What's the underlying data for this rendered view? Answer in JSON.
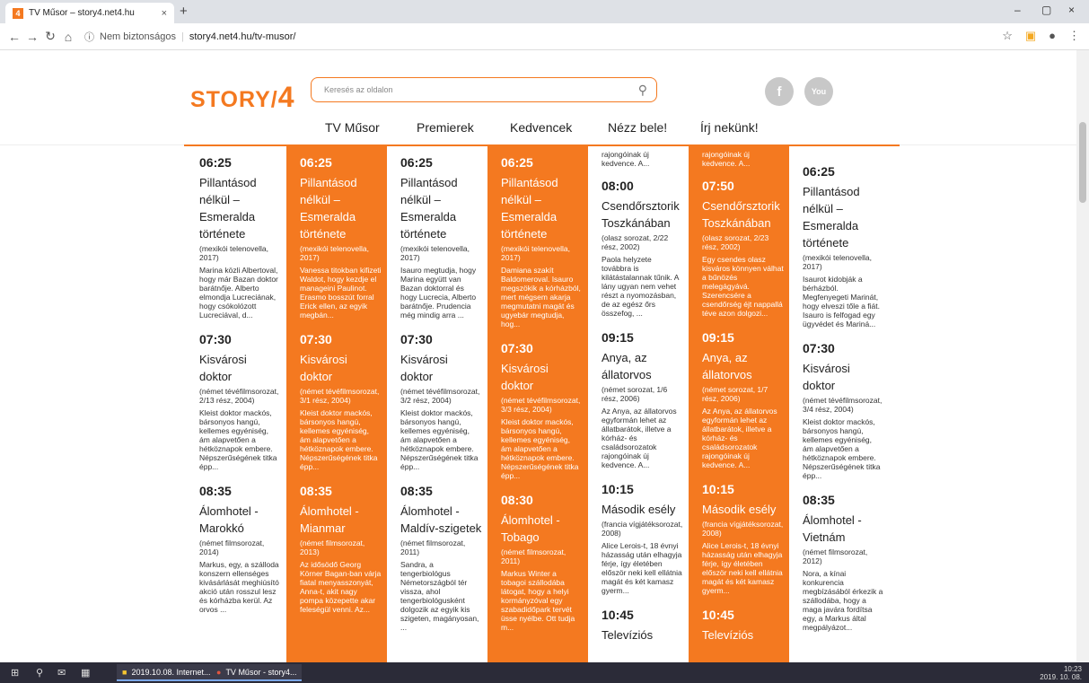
{
  "browser": {
    "tab_title": "TV Műsor – story4.net4.hu",
    "new_tab": "+",
    "security": "Nem biztonságos",
    "url": "story4.net4.hu/tv-musor/",
    "minimize": "–",
    "maximize": "▢",
    "close": "×"
  },
  "site": {
    "logo_text": "STORY/",
    "logo_number": "4",
    "search_placeholder": "Keresés az oldalon",
    "facebook": "f",
    "youtube": "You",
    "menu": [
      "TV Műsor",
      "Premierek",
      "Kedvencek",
      "Nézz bele!",
      "Írj nekünk!"
    ]
  },
  "accent": "#f47920",
  "columns": [
    {
      "orange": false,
      "slots": [
        {
          "time": "06:25",
          "title": "Pillantásod nélkül – Esmeralda története",
          "meta": "(mexikói telenovella, 2017)",
          "desc": "Marina közli Albertoval, hogy már Bazan doktor barátnője. Alberto elmondja Lucreciának, hogy csókolózott Lucreciával, d..."
        },
        {
          "time": "07:30",
          "title": "Kisvárosi doktor",
          "meta": "(német tévéfilmsorozat, 2/13 rész, 2004)",
          "desc": "Kleist doktor mackós, bársonyos hangú, kellemes egyéniség, ám alapvetően a hétköznapok embere. Népszerűségének titka épp..."
        },
        {
          "time": "08:35",
          "title": "Álomhotel - Marokkó",
          "meta": "(német filmsorozat, 2014)",
          "desc": "Markus, egy, a szálloda konszern ellenséges kivásárlását meghiúsító akció után rosszul lesz és kórházba kerül. Az orvos ..."
        }
      ]
    },
    {
      "orange": true,
      "slots": [
        {
          "time": "06:25",
          "title": "Pillantásod nélkül – Esmeralda története",
          "meta": "(mexikói telenovella, 2017)",
          "desc": "Vanessa titokban kifizeti Waldot, hogy kezdje el manageini Paulinot. Erasmo bosszút forral Erick ellen, az egyik megbán..."
        },
        {
          "time": "07:30",
          "title": "Kisvárosi doktor",
          "meta": "(német tévéfilmsorozat, 3/1 rész, 2004)",
          "desc": "Kleist doktor mackós, bársonyos hangú, kellemes egyéniség, ám alapvetően a hétköznapok embere. Népszerűségének titka épp..."
        },
        {
          "time": "08:35",
          "title": "Álomhotel - Mianmar",
          "meta": "(német filmsorozat, 2013)",
          "desc": "Az idősödő Georg Körner Bagan-ban várja fiatal menyasszonyát, Anna-t, akit nagy pompa közepette akar feleségül venni. Az..."
        }
      ]
    },
    {
      "orange": false,
      "slots": [
        {
          "time": "06:25",
          "title": "Pillantásod nélkül – Esmeralda története",
          "meta": "(mexikói telenovella, 2017)",
          "desc": "Isauro megtudja, hogy Marina együtt van Bazan doktorral és hogy Lucrecia, Alberto barátnője. Prudencia még mindig arra ..."
        },
        {
          "time": "07:30",
          "title": "Kisvárosi doktor",
          "meta": "(német tévéfilmsorozat, 3/2 rész, 2004)",
          "desc": "Kleist doktor mackós, bársonyos hangú, kellemes egyéniség, ám alapvetően a hétköznapok embere. Népszerűségének titka épp..."
        },
        {
          "time": "08:35",
          "title": "Álomhotel - Maldív-szigetek",
          "meta": "(német filmsorozat, 2011)",
          "desc": "Sandra, a tengerbiológus Németországból tér vissza, ahol tengerbiológusként dolgozik az egyik kis szigeten, magányosan, ..."
        }
      ]
    },
    {
      "orange": true,
      "slots": [
        {
          "time": "06:25",
          "title": "Pillantásod nélkül – Esmeralda története",
          "meta": "(mexikói telenovella, 2017)",
          "desc": "Damiana szakít Baldomeroval. Isauro megszökik a kórházból, mert mégsem akarja megmutatni magát és ugyebár megtudja, hog..."
        },
        {
          "time": "07:30",
          "title": "Kisvárosi doktor",
          "meta": "(német tévéfilmsorozat, 3/3 rész, 2004)",
          "desc": "Kleist doktor mackós, bársonyos hangú, kellemes egyéniség, ám alapvetően a hétköznapok embere. Népszerűségének titka épp..."
        },
        {
          "time": "08:30",
          "title": "Álomhotel - Tobago",
          "meta": "(német filmsorozat, 2011)",
          "desc": "Markus Winter a tobagoi szállodába látogat, hogy a helyi kormányzóval egy szabadidőpark tervét üsse nyélbe. Ott tudja m..."
        }
      ]
    },
    {
      "orange": false,
      "lead": "rajongóinak új kedvence. A...",
      "slots": [
        {
          "time": "08:00",
          "title": "Csendőrsztorik Toszkánában",
          "meta": "(olasz sorozat, 2/22 rész, 2002)",
          "desc": "Paola helyzete továbbra is kilátástalannak tűnik. A lány ugyan nem vehet részt a nyomozásban, de az egész őrs összefog, ..."
        },
        {
          "time": "09:15",
          "title": "Anya, az állatorvos",
          "meta": "(német sorozat, 1/6 rész, 2006)",
          "desc": "Az Anya, az állatorvos egyformán lehet az állatbarátok, illetve a kórház- és családsorozatok rajongóinak új kedvence. A..."
        },
        {
          "time": "10:15",
          "title": "Második esély",
          "meta": "(francia vígjátéksorozat, 2008)",
          "desc": "Alice Lerois-t, 18 évnyi házasság után elhagyja férje, így életében először neki kell ellátnia magát és két kamasz gyerm..."
        },
        {
          "time": "10:45",
          "title": "Televíziós",
          "meta": "",
          "desc": ""
        }
      ]
    },
    {
      "orange": true,
      "lead": "rajongóinak új kedvence. A...",
      "slots": [
        {
          "time": "07:50",
          "title": "Csendőrsztorik Toszkánában",
          "meta": "(olasz sorozat, 2/23 rész, 2002)",
          "desc": "Egy csendes olasz kisváros könnyen válhat a bűnözés melegágyává. Szerencsére a csendőrség éjt nappallá téve azon dolgozi..."
        },
        {
          "time": "09:15",
          "title": "Anya, az állatorvos",
          "meta": "(német sorozat, 1/7 rész, 2006)",
          "desc": "Az Anya, az állatorvos egyformán lehet az állatbarátok, illetve a kórház- és családsorozatok rajongóinak új kedvence. A..."
        },
        {
          "time": "10:15",
          "title": "Második esély",
          "meta": "(francia vígjátéksorozat, 2008)",
          "desc": "Alice Lerois-t, 18 évnyi házasság után elhagyja férje, így életében először neki kell ellátnia magát és két kamasz gyerm..."
        },
        {
          "time": "10:45",
          "title": "Televíziós",
          "meta": "",
          "desc": ""
        }
      ]
    },
    {
      "orange": false,
      "slots": [
        {
          "time": "06:25",
          "title": "Pillantásod nélkül – Esmeralda története",
          "meta": "(mexikói telenovella, 2017)",
          "desc": "Isaurot kidobják a bérházból. Megfenyegeti Marinát, hogy elveszi tőle a fiát. Isauro is felfogad egy ügyvédet és Mariná..."
        },
        {
          "time": "07:30",
          "title": "Kisvárosi doktor",
          "meta": "(német tévéfilmsorozat, 3/4 rész, 2004)",
          "desc": "Kleist doktor mackós, bársonyos hangú, kellemes egyéniség, ám alapvetően a hétköznapok embere. Népszerűségének titka épp..."
        },
        {
          "time": "08:35",
          "title": "Álomhotel - Vietnám",
          "meta": "(német filmsorozat, 2012)",
          "desc": "Nora, a kínai konkurencia megbízásából érkezik a szállodába, hogy a maga javára fordítsa egy, a Markus által megpályázot..."
        }
      ]
    }
  ],
  "taskbar": {
    "app1": "2019.10.08. Internet...",
    "app2": "TV Műsor - story4...",
    "time": "10:23",
    "date": "2019. 10. 08."
  }
}
